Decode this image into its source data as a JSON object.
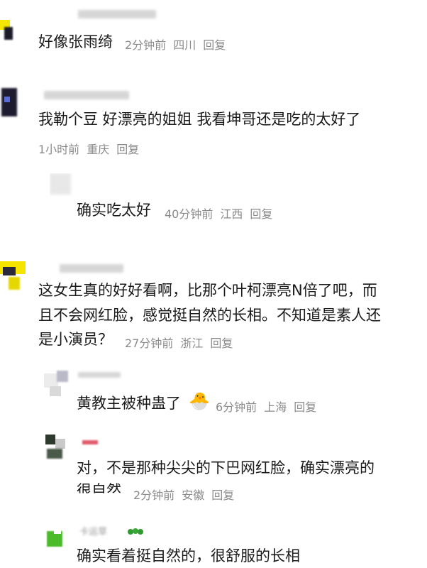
{
  "comments": [
    {
      "text": "好像张雨绮",
      "meta": {
        "time": "2分钟前",
        "location": "四川",
        "reply": "回复"
      }
    },
    {
      "text": "我勒个豆 好漂亮的姐姐 我看坤哥还是吃的太好了",
      "meta": {
        "time": "1小时前",
        "location": "重庆",
        "reply": "回复"
      },
      "replies": [
        {
          "text": "确实吃太好",
          "meta": {
            "time": "40分钟前",
            "location": "江西",
            "reply": "回复"
          }
        }
      ]
    },
    {
      "lines": [
        "这女生真的好好看啊，比那个叶柯漂亮N倍了吧，而",
        "且不会网红脸，感觉挺自然的长相。不知道是素人还",
        "是小演员？"
      ],
      "meta": {
        "time": "27分钟前",
        "location": "浙江",
        "reply": "回复"
      },
      "replies": [
        {
          "text": "黄教主被种蛊了",
          "emoji": "🐣",
          "meta": {
            "time": "6分钟前",
            "location": "上海",
            "reply": "回复"
          }
        },
        {
          "lines": [
            "对，不是那种尖尖的下巴网红脸，确实漂亮的",
            "很自然"
          ],
          "meta": {
            "time": "2分钟前",
            "location": "安徽",
            "reply": "回复"
          }
        },
        {
          "text": "确实看着挺自然的，很舒服的长相"
        }
      ]
    }
  ],
  "blurred_name_fragment": "卡运草"
}
